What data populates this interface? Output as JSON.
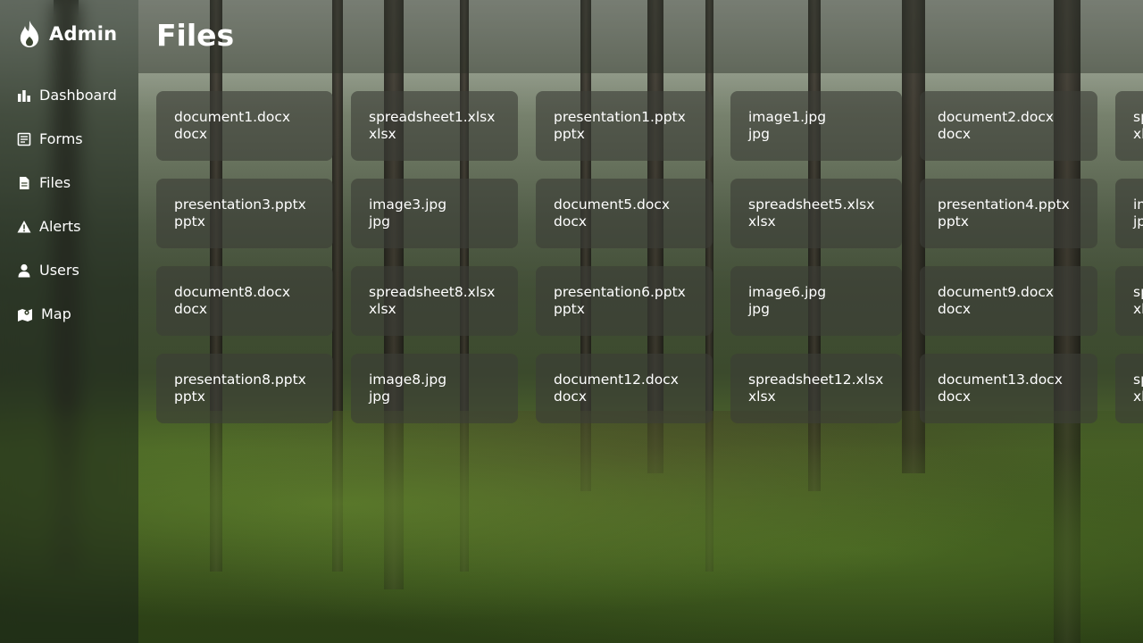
{
  "brand": {
    "name": "Admin",
    "icon": "flame-icon"
  },
  "nav": [
    {
      "label": "Dashboard",
      "icon": "bar-chart-icon"
    },
    {
      "label": "Forms",
      "icon": "form-icon"
    },
    {
      "label": "Files",
      "icon": "file-icon"
    },
    {
      "label": "Alerts",
      "icon": "warning-icon"
    },
    {
      "label": "Users",
      "icon": "user-icon"
    },
    {
      "label": "Map",
      "icon": "map-icon"
    }
  ],
  "page": {
    "title": "Files"
  },
  "files": [
    [
      {
        "name": "document1.docx",
        "ext": "docx"
      },
      {
        "name": "spreadsheet1.xlsx",
        "ext": "xlsx"
      },
      {
        "name": "presentation1.pptx",
        "ext": "pptx"
      },
      {
        "name": "image1.jpg",
        "ext": "jpg"
      },
      {
        "name": "document2.docx",
        "ext": "docx"
      },
      {
        "name": "sp",
        "ext": "xl"
      }
    ],
    [
      {
        "name": "presentation3.pptx",
        "ext": "pptx"
      },
      {
        "name": "image3.jpg",
        "ext": "jpg"
      },
      {
        "name": "document5.docx",
        "ext": "docx"
      },
      {
        "name": "spreadsheet5.xlsx",
        "ext": "xlsx"
      },
      {
        "name": "presentation4.pptx",
        "ext": "pptx"
      },
      {
        "name": "im",
        "ext": "jp"
      }
    ],
    [
      {
        "name": "document8.docx",
        "ext": "docx"
      },
      {
        "name": "spreadsheet8.xlsx",
        "ext": "xlsx"
      },
      {
        "name": "presentation6.pptx",
        "ext": "pptx"
      },
      {
        "name": "image6.jpg",
        "ext": "jpg"
      },
      {
        "name": "document9.docx",
        "ext": "docx"
      },
      {
        "name": "sp",
        "ext": "xl"
      }
    ],
    [
      {
        "name": "presentation8.pptx",
        "ext": "pptx"
      },
      {
        "name": "image8.jpg",
        "ext": "jpg"
      },
      {
        "name": "document12.docx",
        "ext": "docx"
      },
      {
        "name": "spreadsheet12.xlsx",
        "ext": "xlsx"
      },
      {
        "name": "document13.docx",
        "ext": "docx"
      },
      {
        "name": "sp",
        "ext": "xl"
      }
    ]
  ]
}
